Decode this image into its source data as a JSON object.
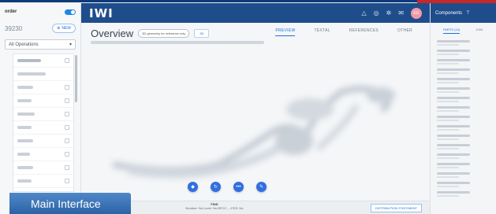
{
  "left_panel": {
    "title": "order",
    "order_number": "39230",
    "new_button_label": "NEW",
    "filter_value": "All Operations",
    "items": [
      {
        "label": ""
      },
      {
        "label": ""
      },
      {
        "label": ""
      },
      {
        "label": ""
      },
      {
        "label": ""
      },
      {
        "label": ""
      },
      {
        "label": ""
      },
      {
        "label": ""
      },
      {
        "label": ""
      },
      {
        "label": ""
      }
    ]
  },
  "appbar": {
    "logo": "IWI",
    "icons": [
      "bell-icon",
      "help-icon",
      "settings-icon",
      "mail-icon"
    ],
    "avatar_initials": "EG"
  },
  "main": {
    "title": "Overview",
    "pill_label": "3D geometry for reference only",
    "pill_button_label": "3D",
    "tabs": [
      {
        "label": "PREVIEW",
        "active": true
      },
      {
        "label": "TEXTAL",
        "active": false
      },
      {
        "label": "REFERENCES",
        "active": false
      },
      {
        "label": "OTHER",
        "active": false
      }
    ],
    "fab_icons": [
      "cube-icon",
      "refresh-icon",
      "more-icon",
      "edit-icon"
    ]
  },
  "footer": {
    "title": "FIND",
    "meta": "Number: No    Level: No    BFCC: --    ESS: No",
    "distribution_label": "DISTRIBUTION STATEMENT"
  },
  "right_panel": {
    "title": "Components",
    "tabs": [
      {
        "label": "PARTS (10)",
        "active": true
      },
      {
        "label": "JOIN",
        "active": false
      }
    ]
  },
  "caption": {
    "label": "Main Interface"
  },
  "colors": {
    "appbar": "#1f4d8c",
    "accent": "#1e6fd9",
    "caption": "#3a73b8"
  }
}
